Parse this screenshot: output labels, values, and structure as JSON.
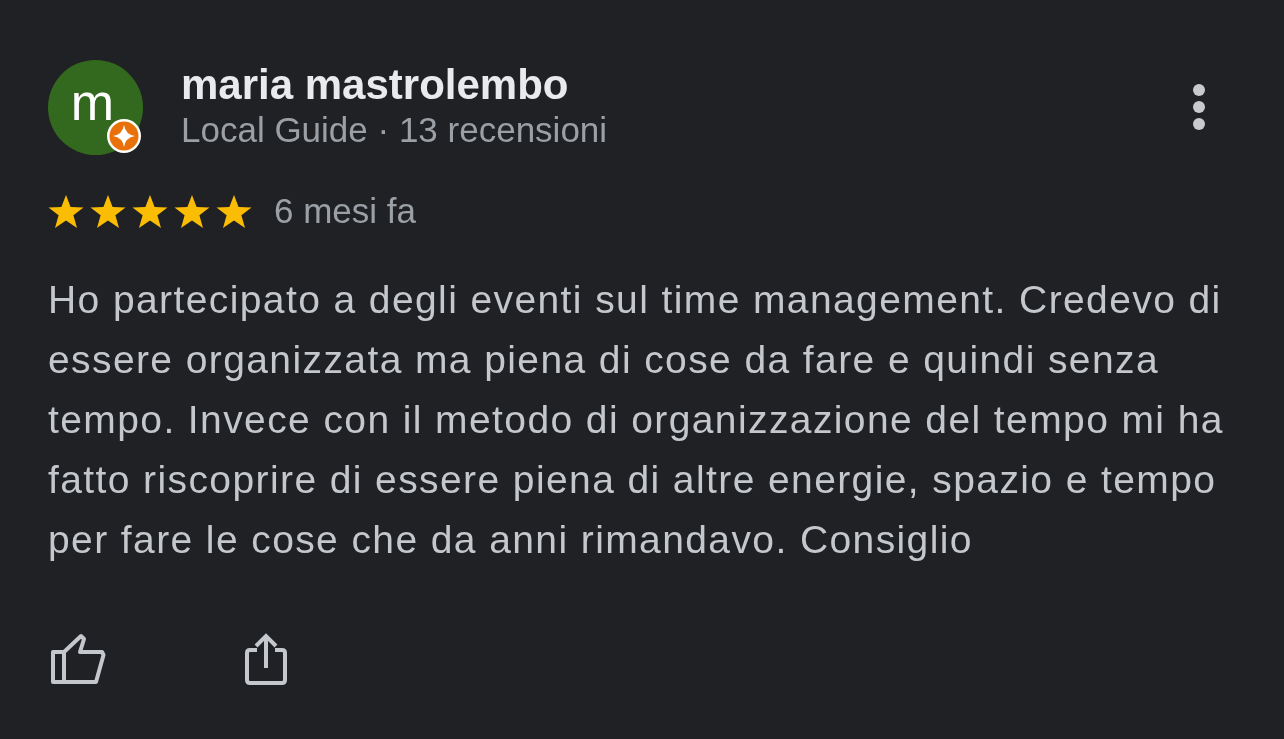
{
  "review": {
    "author": {
      "initial": "m",
      "local_guide": true,
      "name": "maria mastrolembo",
      "details": "Local Guide · 13 recensioni"
    },
    "stars": 5,
    "time": "6 mesi fa",
    "text": "Ho partecipato a degli eventi sul time management. Credevo di essere organizzata ma piena di cose da fare e quindi senza tempo. Invece con il metodo di organizzazione del tempo mi ha fatto riscoprire di essere piena di altre energie, spazio e tempo per fare le cose che da anni rimandavo. Consiglio"
  }
}
